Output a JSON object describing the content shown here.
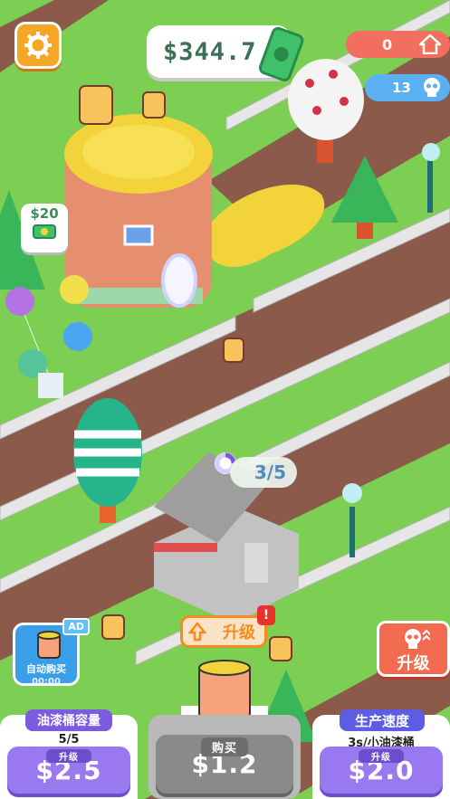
{
  "hud": {
    "money": "$344.7",
    "home_count": "0",
    "gem_count": "13",
    "shop_price": "$20",
    "build_progress": "3/5",
    "upgrade_label": "升级",
    "alert_mark": "!",
    "speed_upgrade_label": "升级"
  },
  "auto_buy": {
    "label": "自动购买",
    "ad_badge": "AD",
    "timer": "00:00"
  },
  "panels": {
    "capacity": {
      "title": "油漆桶容量",
      "value": "5/5",
      "level_tag": "升级",
      "price": "$2.5"
    },
    "buy": {
      "label": "购买",
      "price": "$1.2"
    },
    "speed": {
      "title": "生产速度",
      "value": "3s/小油漆桶",
      "level_tag": "升级",
      "price": "$2.0"
    }
  },
  "colors": {
    "grass": "#7ccf53",
    "road": "#8b5a4a",
    "accent_orange": "#f58a1f",
    "purple": "#9a78ef"
  }
}
